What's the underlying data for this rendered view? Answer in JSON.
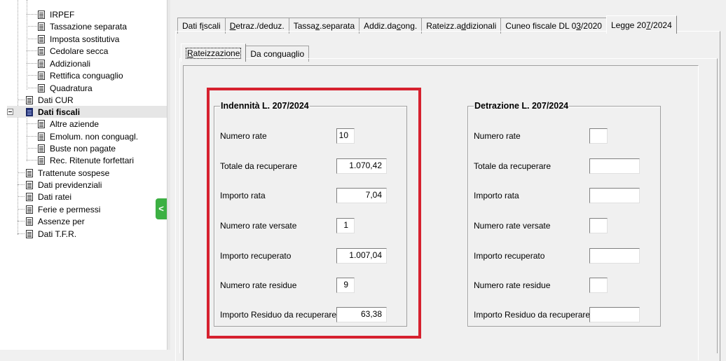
{
  "tree": {
    "items": [
      {
        "label": "IRPEF"
      },
      {
        "label": "Tassazione separata"
      },
      {
        "label": "Imposta sostitutiva"
      },
      {
        "label": "Cedolare secca"
      },
      {
        "label": "Addizionali"
      },
      {
        "label": "Rettifica conguaglio"
      },
      {
        "label": "Quadratura"
      },
      {
        "label": "Dati CUR"
      },
      {
        "label": "Dati fiscali"
      },
      {
        "label": "Altre aziende"
      },
      {
        "label": "Emolum. non conguagl."
      },
      {
        "label": "Buste non pagate"
      },
      {
        "label": "Rec. Ritenute forfettari"
      },
      {
        "label": "Trattenute sospese"
      },
      {
        "label": "Dati previdenziali"
      },
      {
        "label": "Dati ratei"
      },
      {
        "label": "Ferie e permessi"
      },
      {
        "label": "Assenze per"
      },
      {
        "label": "Dati T.F.R."
      }
    ],
    "collapse_glyph": "<"
  },
  "main_tabs": [
    {
      "pre": "Dati f",
      "acc": "i",
      "post": "scali"
    },
    {
      "pre": "",
      "acc": "D",
      "post": "etraz./deduz."
    },
    {
      "pre": "Tassa",
      "acc": "z",
      "post": ".separata"
    },
    {
      "pre": "Addiz.da ",
      "acc": "c",
      "post": "ong."
    },
    {
      "pre": "Rateizz.a",
      "acc": "d",
      "post": "dizionali"
    },
    {
      "pre": "Cuneo fiscale DL 0",
      "acc": "3",
      "post": "/2020"
    },
    {
      "pre": "Legge 20",
      "acc": "7",
      "post": "/2024"
    }
  ],
  "sub_tabs": [
    {
      "pre": "",
      "acc": "R",
      "post": "ateizzazione"
    },
    {
      "pre": "Da con",
      "acc": "g",
      "post": "uaglio"
    }
  ],
  "left_group": {
    "title": "Indennità L. 207/2024",
    "rows": [
      {
        "label": "Numero rate",
        "value": "10"
      },
      {
        "label": "Totale da recuperare",
        "value": "1.070,42"
      },
      {
        "label": "Importo rata",
        "value": "7,04"
      },
      {
        "label": "Numero rate versate",
        "value": "1"
      },
      {
        "label": "Importo recuperato",
        "value": "1.007,04"
      },
      {
        "label": "Numero rate residue",
        "value": "9"
      },
      {
        "label": "Importo Residuo da recuperare",
        "value": "63,38"
      }
    ]
  },
  "right_group": {
    "title": "Detrazione L. 207/2024",
    "rows": [
      {
        "label": "Numero rate",
        "value": ""
      },
      {
        "label": "Totale da recuperare",
        "value": ""
      },
      {
        "label": "Importo rata",
        "value": ""
      },
      {
        "label": "Numero rate versate",
        "value": ""
      },
      {
        "label": "Importo recuperato",
        "value": ""
      },
      {
        "label": "Numero rate residue",
        "value": ""
      },
      {
        "label": "Importo Residuo da recuperare",
        "value": ""
      }
    ]
  },
  "colors": {
    "highlight": "#d6212f",
    "collapse_button": "#3cb043"
  }
}
